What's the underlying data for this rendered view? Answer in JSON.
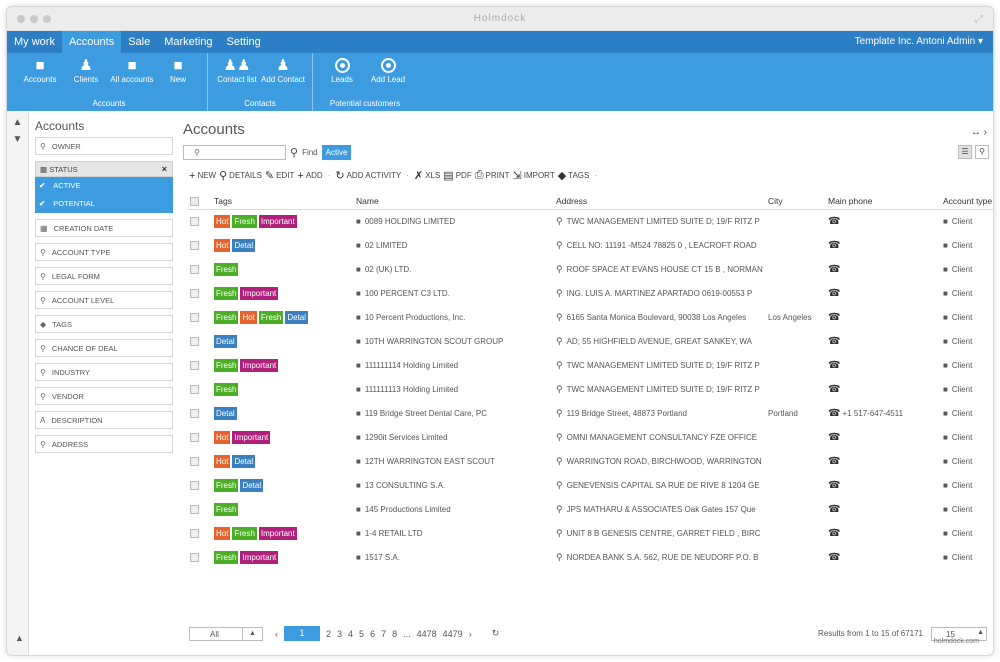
{
  "window": {
    "title": "Holmdock"
  },
  "menubar": {
    "tabs": [
      "My work",
      "Accounts",
      "Sale",
      "Marketing",
      "Setting"
    ],
    "active_index": 1,
    "user": "Template Inc.  Antoni Admin"
  },
  "ribbon": {
    "groups": [
      {
        "label": "Accounts",
        "items": [
          "Accounts",
          "Clients",
          "All accounts",
          "New"
        ]
      },
      {
        "label": "Contacts",
        "items": [
          "Contact list",
          "Add Contact"
        ]
      },
      {
        "label": "Potential customers",
        "items": [
          "Leads",
          "Add Lead"
        ]
      }
    ]
  },
  "filters": {
    "title": "Accounts",
    "owner": "OWNER",
    "status_label": "STATUS",
    "status_options": [
      "ACTIVE",
      "POTENTIAL"
    ],
    "items": [
      "CREATION DATE",
      "ACCOUNT TYPE",
      "LEGAL FORM",
      "ACCOUNT LEVEL",
      "TAGS",
      "CHANCE OF DEAL",
      "INDUSTRY",
      "VENDOR",
      "DESCRIPTION",
      "ADDRESS"
    ]
  },
  "main": {
    "title": "Accounts",
    "find_label": "Find",
    "active_badge": "Active",
    "toolbar": [
      "NEW",
      "DETAILS",
      "EDIT",
      "ADD",
      "ADD ACTIVITY",
      "XLS",
      "PDF",
      "PRINT",
      "IMPORT",
      "TAGS"
    ]
  },
  "table": {
    "columns": [
      "Tags",
      "Name",
      "Address",
      "City",
      "Main phone",
      "Account type"
    ],
    "rows": [
      {
        "tags": [
          "Hot",
          "Fresh",
          "Important"
        ],
        "name": "0089 HOLDING LIMITED",
        "address": "TWC MANAGEMENT LIMITED SUITE D; 19/F RITZ P",
        "city": "",
        "phone": "",
        "type": "Client"
      },
      {
        "tags": [
          "Hot",
          "Detal"
        ],
        "name": "02 LIMITED",
        "address": "CELL NO: 11191 -M524 78825 0 , LEACROFT ROAD",
        "city": "",
        "phone": "",
        "type": "Client"
      },
      {
        "tags": [
          "Fresh"
        ],
        "name": "02 (UK) LTD.",
        "address": "ROOF SPACE AT EVANS HOUSE CT 15 B , NORMAN",
        "city": "",
        "phone": "",
        "type": "Client"
      },
      {
        "tags": [
          "Fresh",
          "Important"
        ],
        "name": "100 PERCENT C3 LTD.",
        "address": "ING. LUIS A. MARTINEZ APARTADO 0619-00553 P",
        "city": "",
        "phone": "",
        "type": "Client"
      },
      {
        "tags": [
          "Fresh",
          "Hot",
          "Fresh",
          "Detal"
        ],
        "name": "10 Percent Productions, Inc.",
        "address": "6165 Santa Monica Boulevard, 90038 Los Angeles",
        "city": "Los Angeles",
        "phone": "",
        "type": "Client"
      },
      {
        "tags": [
          "Detal"
        ],
        "name": "10TH WARRINGTON SCOUT GROUP",
        "address": "AD; 55 HIGHFIELD AVENUE, GREAT SANKEY, WA",
        "city": "",
        "phone": "",
        "type": "Client"
      },
      {
        "tags": [
          "Fresh",
          "Important"
        ],
        "name": "111111114 Holding Limited",
        "address": "TWC MANAGEMENT LIMITED SUITE D; 19/F RITZ P",
        "city": "",
        "phone": "",
        "type": "Client"
      },
      {
        "tags": [
          "Fresh"
        ],
        "name": "111111113 Holding Limited",
        "address": "TWC MANAGEMENT LIMITED SUITE D; 19/F RITZ P",
        "city": "",
        "phone": "",
        "type": "Client"
      },
      {
        "tags": [
          "Detal"
        ],
        "name": "119 Bridge Street Dental Care, PC",
        "address": "119 Bridge Street, 48873 Portland",
        "city": "Portland",
        "phone": "+1 517-647-4511",
        "type": "Client"
      },
      {
        "tags": [
          "Hot",
          "Important"
        ],
        "name": "1290it Services Limited",
        "address": "OMNI MANAGEMENT CONSULTANCY FZE OFFICE",
        "city": "",
        "phone": "",
        "type": "Client"
      },
      {
        "tags": [
          "Hot",
          "Detal"
        ],
        "name": "12TH WARRINGTON EAST SCOUT",
        "address": "WARRINGTON ROAD, BIRCHWOOD, WARRINGTON",
        "city": "",
        "phone": "",
        "type": "Client"
      },
      {
        "tags": [
          "Fresh",
          "Detal"
        ],
        "name": "13 CONSULTING S.A.",
        "address": "GENEVENSIS CAPITAL SA RUE DE RIVE 8 1204 GE",
        "city": "",
        "phone": "",
        "type": "Client"
      },
      {
        "tags": [
          "Fresh"
        ],
        "name": "145 Productions Limited",
        "address": "JPS MATHARU & ASSOCIATES Oak Gates 157 Que",
        "city": "",
        "phone": "",
        "type": "Client"
      },
      {
        "tags": [
          "Hot",
          "Fresh",
          "Important"
        ],
        "name": "1-4 RETAIL LTD",
        "address": "UNIT 8 B GENESIS CENTRE, GARRET FIELD , BIRC",
        "city": "",
        "phone": "",
        "type": "Client"
      },
      {
        "tags": [
          "Fresh",
          "Important"
        ],
        "name": "1517 S.A.",
        "address": "NORDEA BANK S.A. 562, RUE DE NEUDORF P.O. B",
        "city": "",
        "phone": "",
        "type": "Client"
      }
    ]
  },
  "pager": {
    "select_value": "All",
    "current_page": "1",
    "pages": [
      "2",
      "3",
      "4",
      "5",
      "6",
      "7",
      "8",
      "...",
      "4478",
      "4479"
    ],
    "results": "Results from 1 to 15 of 67171",
    "page_size": "15"
  },
  "footer": {
    "brand": "holmdock.com"
  },
  "colors": {
    "accent": "#3d9be0",
    "menubar": "#2c7fc4",
    "hot": "#e8632b",
    "fresh": "#4cae27",
    "important": "#b0207a",
    "detal": "#3a7fbf"
  }
}
